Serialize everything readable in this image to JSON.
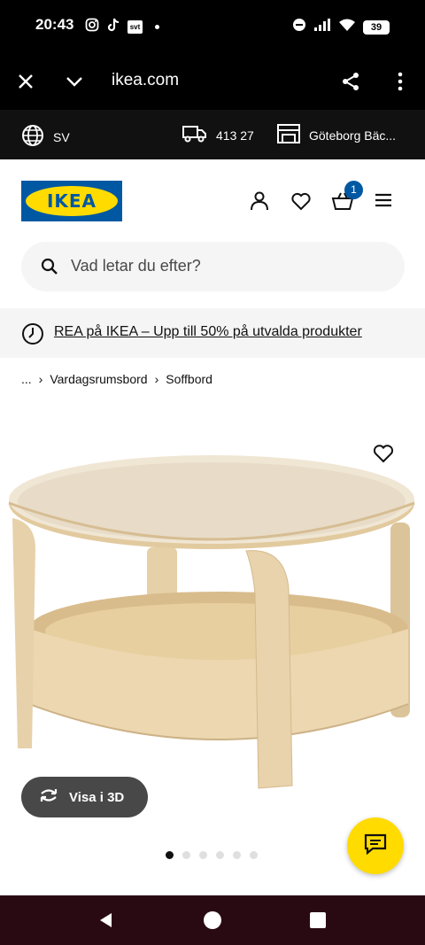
{
  "status_bar": {
    "time": "20:43",
    "battery": "39",
    "icons": [
      "instagram-icon",
      "tiktok-icon",
      "svt-icon",
      "dot-icon",
      "dnd-icon",
      "signal-icon",
      "wifi-icon",
      "battery-icon"
    ],
    "svt_label": "svt"
  },
  "browser": {
    "url": "ikea.com",
    "icons": [
      "close-icon",
      "chevron-down-icon",
      "share-icon",
      "more-vert-icon"
    ]
  },
  "top_strip": {
    "language": "SV",
    "postal_code": "413 27",
    "store": "Göteborg Bäc..."
  },
  "header": {
    "logo_text": "IKEA",
    "cart_count": "1",
    "icons": [
      "profile-icon",
      "heart-icon",
      "cart-icon",
      "menu-icon"
    ]
  },
  "search": {
    "placeholder": "Vad letar du efter?"
  },
  "promo": {
    "text": "REA på IKEA – Upp till 50% på utvalda produkter"
  },
  "breadcrumb": {
    "ellipsis": "...",
    "items": [
      "Vardagsrumsbord",
      "Soffbord"
    ]
  },
  "product": {
    "visa_3d": "Visa i 3D",
    "image_count": 6,
    "active_image": 1
  },
  "colors": {
    "ikea_blue": "#0058a3",
    "ikea_yellow": "#ffdb00",
    "wood": "#e8d3ac"
  }
}
